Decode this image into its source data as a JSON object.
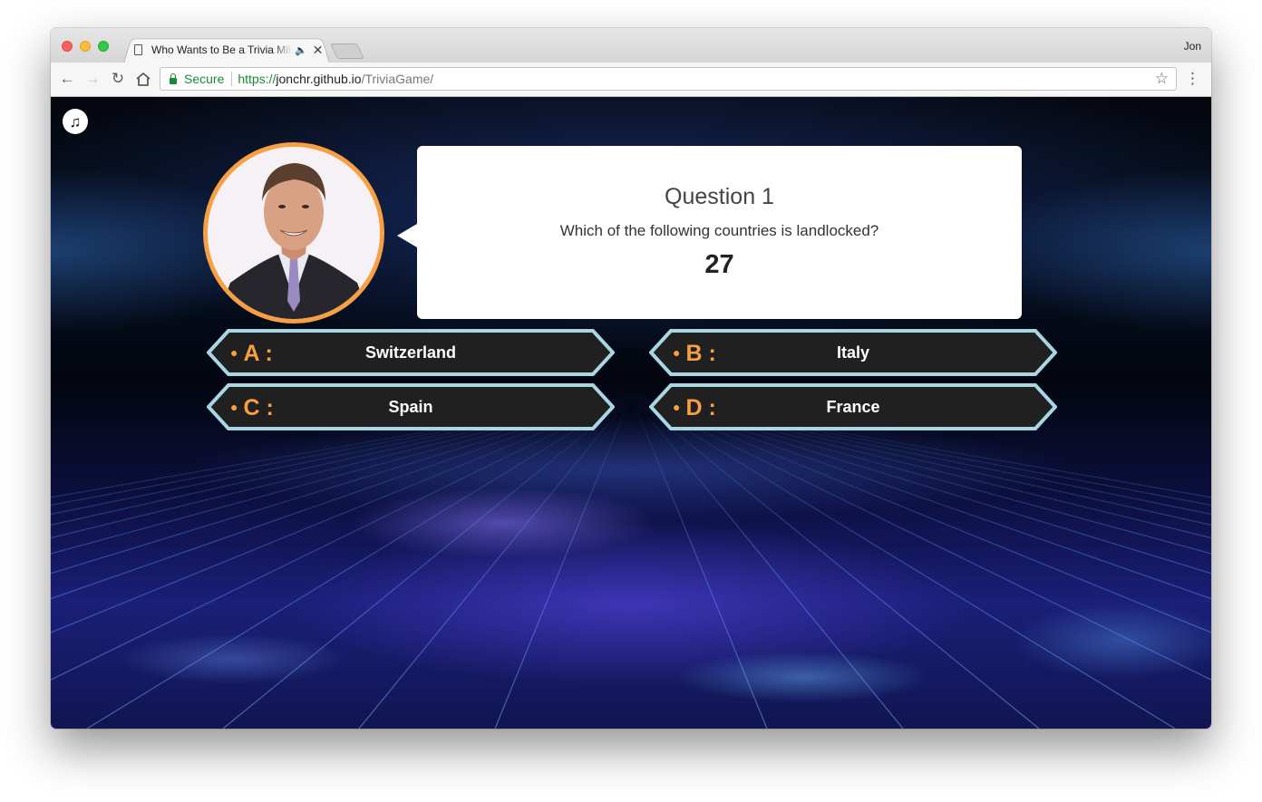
{
  "browser": {
    "tab_title": "Who Wants to Be a Trivia Millionaire",
    "profile_name": "Jon",
    "secure_label": "Secure",
    "url_scheme": "https://",
    "url_host": "jonchr.github.io",
    "url_path": "/TriviaGame/",
    "nav_icons": [
      "back-icon",
      "forward-icon",
      "reload-icon",
      "home-icon"
    ],
    "right_icons": [
      "bookmark-star-icon",
      "menu-icon"
    ]
  },
  "game": {
    "music_icon": "music-note-icon",
    "question_label": "Question 1",
    "question_text": "Which of the following countries is landlocked?",
    "timer": "27",
    "answers": [
      {
        "letter": "A :",
        "text": "Switzerland"
      },
      {
        "letter": "B :",
        "text": "Italy"
      },
      {
        "letter": "C :",
        "text": "Spain"
      },
      {
        "letter": "D :",
        "text": "France"
      }
    ]
  },
  "colors": {
    "accent": "#f79f42",
    "answer_border": "#a9d6e5",
    "answer_fill": "#202020",
    "secure_green": "#1a8a32"
  }
}
